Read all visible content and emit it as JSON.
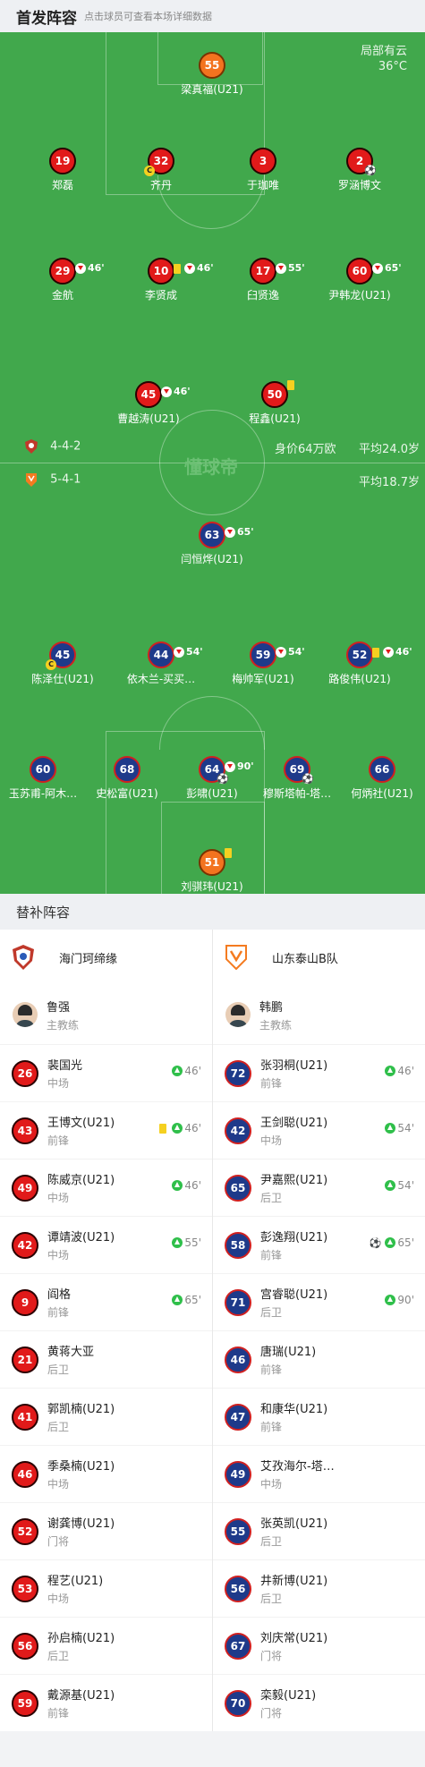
{
  "header": {
    "title": "首发阵容",
    "hint": "点击球员可查看本场详细数据"
  },
  "weather": {
    "desc": "局部有云",
    "temp": "36°C"
  },
  "watermark": "懂球帝",
  "home": {
    "formation": "4-4-2",
    "value": "身价64万欧",
    "avg_age": "平均24.0岁",
    "color": "#e11a1a"
  },
  "away": {
    "formation": "5-4-1",
    "avg_age": "平均18.7岁",
    "color": "#1e3a8a"
  },
  "home_players": [
    {
      "num": "55",
      "name": "梁真福(U21)",
      "gk": true,
      "events": []
    },
    {
      "num": "19",
      "name": "郑磊",
      "events": []
    },
    {
      "num": "32",
      "name": "齐丹",
      "captain": true,
      "events": []
    },
    {
      "num": "3",
      "name": "于珈唯",
      "events": []
    },
    {
      "num": "2",
      "name": "罗涵博文",
      "ball": true,
      "events": []
    },
    {
      "num": "29",
      "name": "金航",
      "events": [
        {
          "type": "sub",
          "min": "46'"
        }
      ]
    },
    {
      "num": "10",
      "name": "李贤成",
      "events": [
        {
          "type": "yellow"
        },
        {
          "type": "sub",
          "min": "46'"
        }
      ]
    },
    {
      "num": "17",
      "name": "臼贤逸",
      "events": [
        {
          "type": "sub",
          "min": "55'"
        }
      ]
    },
    {
      "num": "60",
      "name": "尹韩龙(U21)",
      "events": [
        {
          "type": "sub",
          "min": "65'"
        }
      ]
    },
    {
      "num": "45",
      "name": "曹越涛(U21)",
      "events": [
        {
          "type": "sub",
          "min": "46'"
        }
      ]
    },
    {
      "num": "50",
      "name": "程鑫(U21)",
      "events": [
        {
          "type": "yellow"
        }
      ]
    }
  ],
  "away_players": [
    {
      "num": "63",
      "name": "闫恒烨(U21)",
      "events": [
        {
          "type": "sub",
          "min": "65'"
        }
      ]
    },
    {
      "num": "45",
      "name": "陈泽仕(U21)",
      "captain": true,
      "events": []
    },
    {
      "num": "44",
      "name": "依木兰-买买…",
      "events": [
        {
          "type": "sub",
          "min": "54'"
        }
      ]
    },
    {
      "num": "59",
      "name": "梅帅军(U21)",
      "events": [
        {
          "type": "sub",
          "min": "54'"
        }
      ]
    },
    {
      "num": "52",
      "name": "路俊伟(U21)",
      "events": [
        {
          "type": "yellow"
        },
        {
          "type": "sub",
          "min": "46'"
        }
      ]
    },
    {
      "num": "60",
      "name": "玉苏甫-阿木…",
      "events": []
    },
    {
      "num": "68",
      "name": "史松富(U21)",
      "events": []
    },
    {
      "num": "64",
      "name": "彭啸(U21)",
      "assist": true,
      "events": [
        {
          "type": "sub",
          "min": "90'"
        }
      ]
    },
    {
      "num": "69",
      "name": "穆斯塔帕-塔…",
      "ball": true,
      "events": []
    },
    {
      "num": "66",
      "name": "何炳社(U21)",
      "events": []
    },
    {
      "num": "51",
      "name": "刘骐玮(U21)",
      "gk": true,
      "events": [
        {
          "type": "yellow"
        }
      ]
    }
  ],
  "subs": {
    "title": "替补阵容",
    "home": {
      "team": "海门珂缔缘",
      "coach": {
        "name": "鲁强",
        "role": "主教练"
      },
      "players": [
        {
          "num": "26",
          "name": "裴国光",
          "pos": "中场",
          "min": "46'"
        },
        {
          "num": "43",
          "name": "王博文(U21)",
          "pos": "前锋",
          "min": "46'",
          "yellow": true
        },
        {
          "num": "49",
          "name": "陈威京(U21)",
          "pos": "中场",
          "min": "46'"
        },
        {
          "num": "42",
          "name": "谭靖波(U21)",
          "pos": "中场",
          "min": "55'"
        },
        {
          "num": "9",
          "name": "阎格",
          "pos": "前锋",
          "min": "65'"
        },
        {
          "num": "21",
          "name": "黄蒋大亚",
          "pos": "后卫"
        },
        {
          "num": "41",
          "name": "郭凯楠(U21)",
          "pos": "后卫"
        },
        {
          "num": "46",
          "name": "季桑楠(U21)",
          "pos": "中场"
        },
        {
          "num": "52",
          "name": "谢龚博(U21)",
          "pos": "门将"
        },
        {
          "num": "53",
          "name": "程艺(U21)",
          "pos": "中场"
        },
        {
          "num": "56",
          "name": "孙启楠(U21)",
          "pos": "后卫"
        },
        {
          "num": "59",
          "name": "戴源基(U21)",
          "pos": "前锋"
        }
      ]
    },
    "away": {
      "team": "山东泰山B队",
      "coach": {
        "name": "韩鹏",
        "role": "主教练"
      },
      "players": [
        {
          "num": "72",
          "name": "张羽桐(U21)",
          "pos": "前锋",
          "min": "46'"
        },
        {
          "num": "42",
          "name": "王剑聪(U21)",
          "pos": "中场",
          "min": "54'"
        },
        {
          "num": "65",
          "name": "尹嘉熙(U21)",
          "pos": "后卫",
          "min": "54'"
        },
        {
          "num": "58",
          "name": "彭逸翔(U21)",
          "pos": "前锋",
          "min": "65'",
          "goal": true
        },
        {
          "num": "71",
          "name": "宫睿聪(U21)",
          "pos": "后卫",
          "min": "90'"
        },
        {
          "num": "46",
          "name": "唐瑞(U21)",
          "pos": "前锋"
        },
        {
          "num": "47",
          "name": "和康华(U21)",
          "pos": "前锋"
        },
        {
          "num": "49",
          "name": "艾孜海尔-塔…",
          "pos": "中场"
        },
        {
          "num": "55",
          "name": "张英凯(U21)",
          "pos": "后卫"
        },
        {
          "num": "56",
          "name": "井新博(U21)",
          "pos": "后卫"
        },
        {
          "num": "67",
          "name": "刘庆常(U21)",
          "pos": "门将"
        },
        {
          "num": "70",
          "name": "栾毅(U21)",
          "pos": "门将"
        }
      ]
    }
  }
}
